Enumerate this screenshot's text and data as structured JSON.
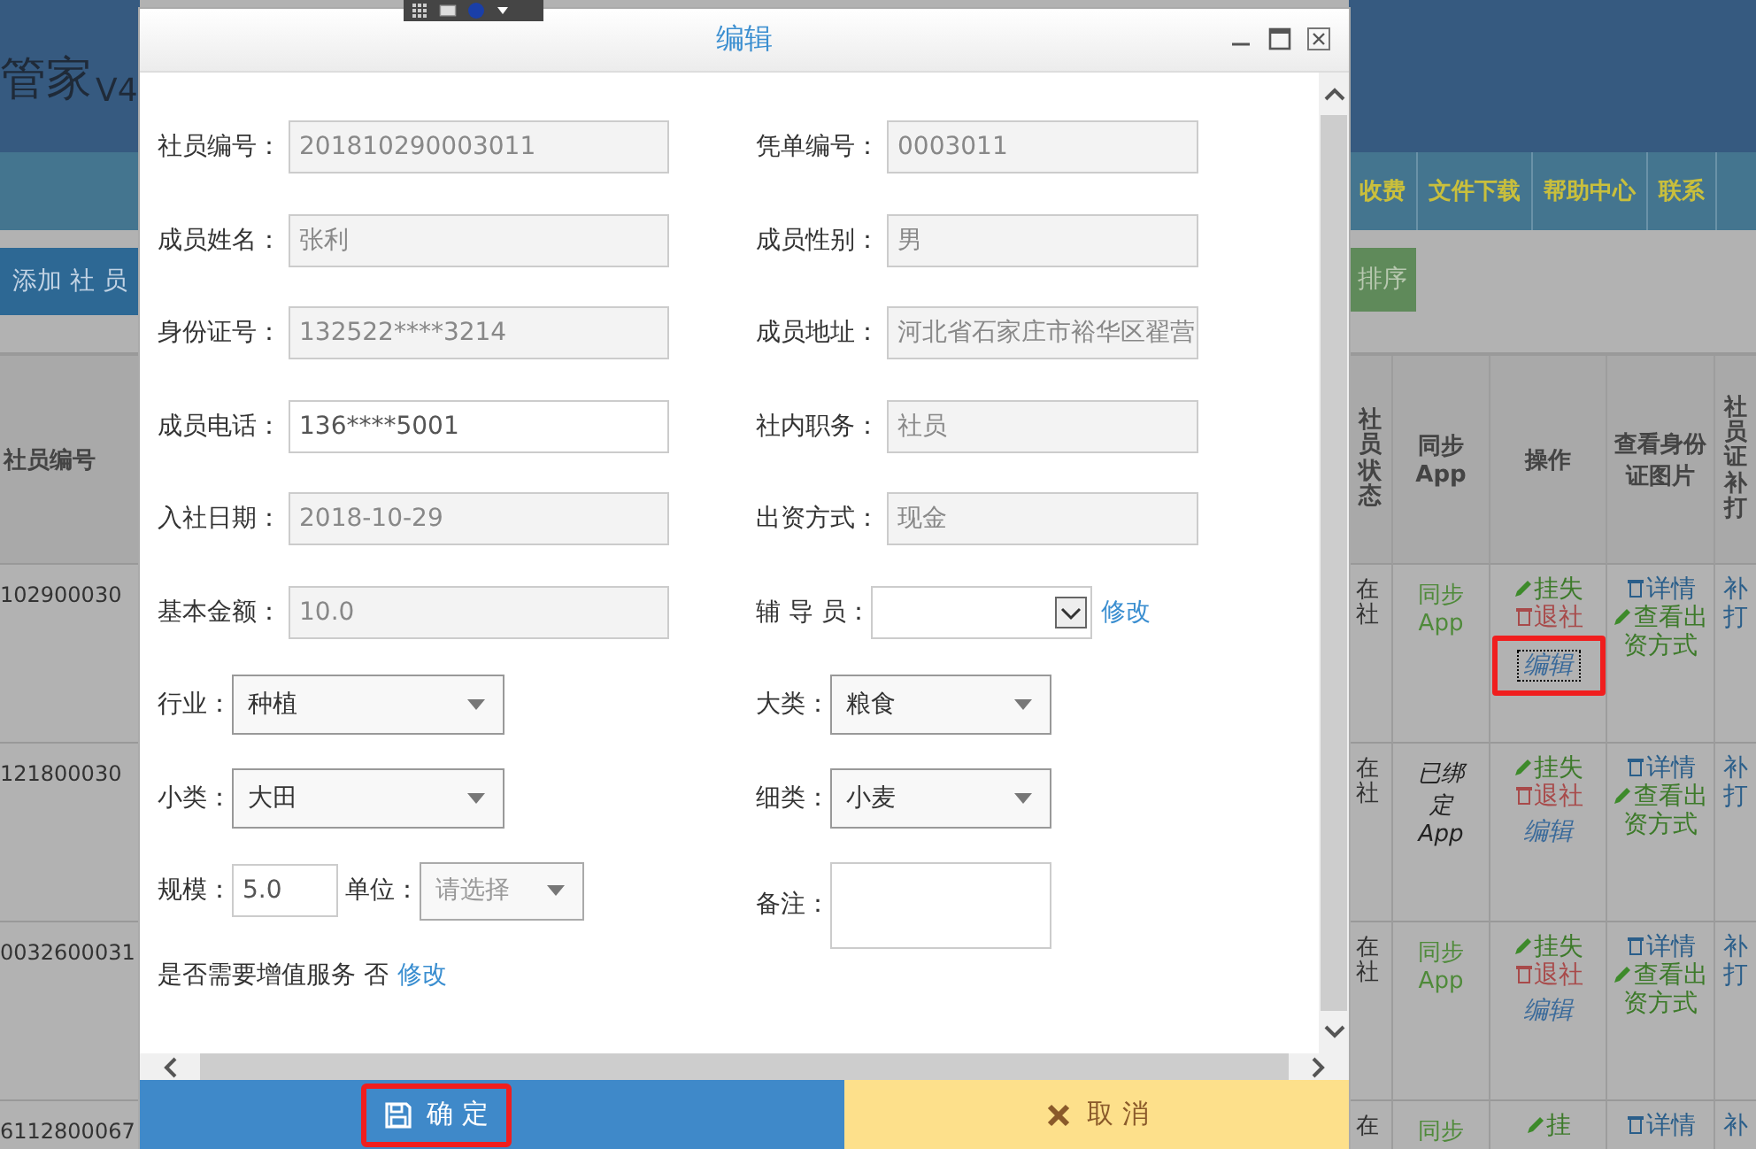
{
  "background": {
    "logo": "管家",
    "version": "V4",
    "nav": [
      "收费",
      "文件下载",
      "帮助中心",
      "联系"
    ],
    "add_button": "添加 社 员",
    "sort_button": "排序",
    "id_column": "社员编号",
    "columns": [
      "社员状态",
      "同步App",
      "操作",
      "查看身份证图片",
      "社员证补打"
    ],
    "rows": [
      {
        "id": "102900030",
        "status": "在社",
        "sync": "同步App",
        "bound": false,
        "loss": "挂失",
        "quit": "退社",
        "edit": "编辑",
        "highlighted": true,
        "view": "详情",
        "funding": "查看出资方式",
        "reprint": "补打"
      },
      {
        "id": "121800030",
        "status": "在社",
        "sync": "已绑定App",
        "bound": true,
        "loss": "挂失",
        "quit": "退社",
        "edit": "编辑",
        "highlighted": false,
        "view": "详情",
        "funding": "查看出资方式",
        "reprint": "补打"
      },
      {
        "id": "0032600031",
        "status": "在社",
        "sync": "同步App",
        "bound": false,
        "loss": "挂失",
        "quit": "退社",
        "edit": "编辑",
        "highlighted": false,
        "view": "详情",
        "funding": "查看出资方式",
        "reprint": "补打"
      },
      {
        "id": "6112800067",
        "status": "在",
        "sync": "同步",
        "bound": false,
        "loss": "挂",
        "view": "详情",
        "reprint": "补"
      }
    ]
  },
  "dialog": {
    "title": "编辑",
    "rows": [
      [
        {
          "label": "社员编号：",
          "kind": "readonly",
          "value": "201810290003011"
        },
        {
          "label": "凭单编号：",
          "kind": "readonly",
          "value": "0003011"
        }
      ],
      [
        {
          "label": "成员姓名：",
          "kind": "readonly",
          "value": "张利"
        },
        {
          "label": "成员性别：",
          "kind": "readonly",
          "value": "男"
        }
      ],
      [
        {
          "label": "身份证号：",
          "kind": "readonly",
          "value": "132522****3214"
        },
        {
          "label": "成员地址：",
          "kind": "readonly",
          "value": "河北省石家庄市裕华区翟营"
        }
      ],
      [
        {
          "label": "成员电话：",
          "kind": "input",
          "value": "136****5001"
        },
        {
          "label": "社内职务：",
          "kind": "readonly",
          "value": "社员"
        }
      ],
      [
        {
          "label": "入社日期：",
          "kind": "readonly",
          "value": "2018-10-29"
        },
        {
          "label": "出资方式：",
          "kind": "readonly",
          "value": "现金"
        }
      ],
      [
        {
          "label": "基本金额：",
          "kind": "readonly",
          "value": "10.0"
        },
        {
          "label": "辅 导 员：",
          "kind": "combo",
          "link": "修改"
        }
      ],
      [
        {
          "label": "行业：",
          "kind": "select",
          "value": "种植"
        },
        {
          "label": "大类：",
          "kind": "select",
          "value": "粮食"
        }
      ],
      [
        {
          "label": "小类：",
          "kind": "select",
          "value": "大田"
        },
        {
          "label": "细类：",
          "kind": "select",
          "value": "小麦"
        }
      ],
      [
        {
          "label": "规模：",
          "kind": "scale",
          "value": "5.0",
          "unit_label": "单位：",
          "unit_placeholder": "请选择"
        },
        {
          "label": "备注：",
          "kind": "textarea"
        }
      ]
    ],
    "service": {
      "text": "是否需要增值服务 否",
      "link": "修改"
    },
    "confirm": {
      "label": "确 定",
      "highlighted": true
    },
    "cancel": {
      "label": "取 消"
    }
  }
}
